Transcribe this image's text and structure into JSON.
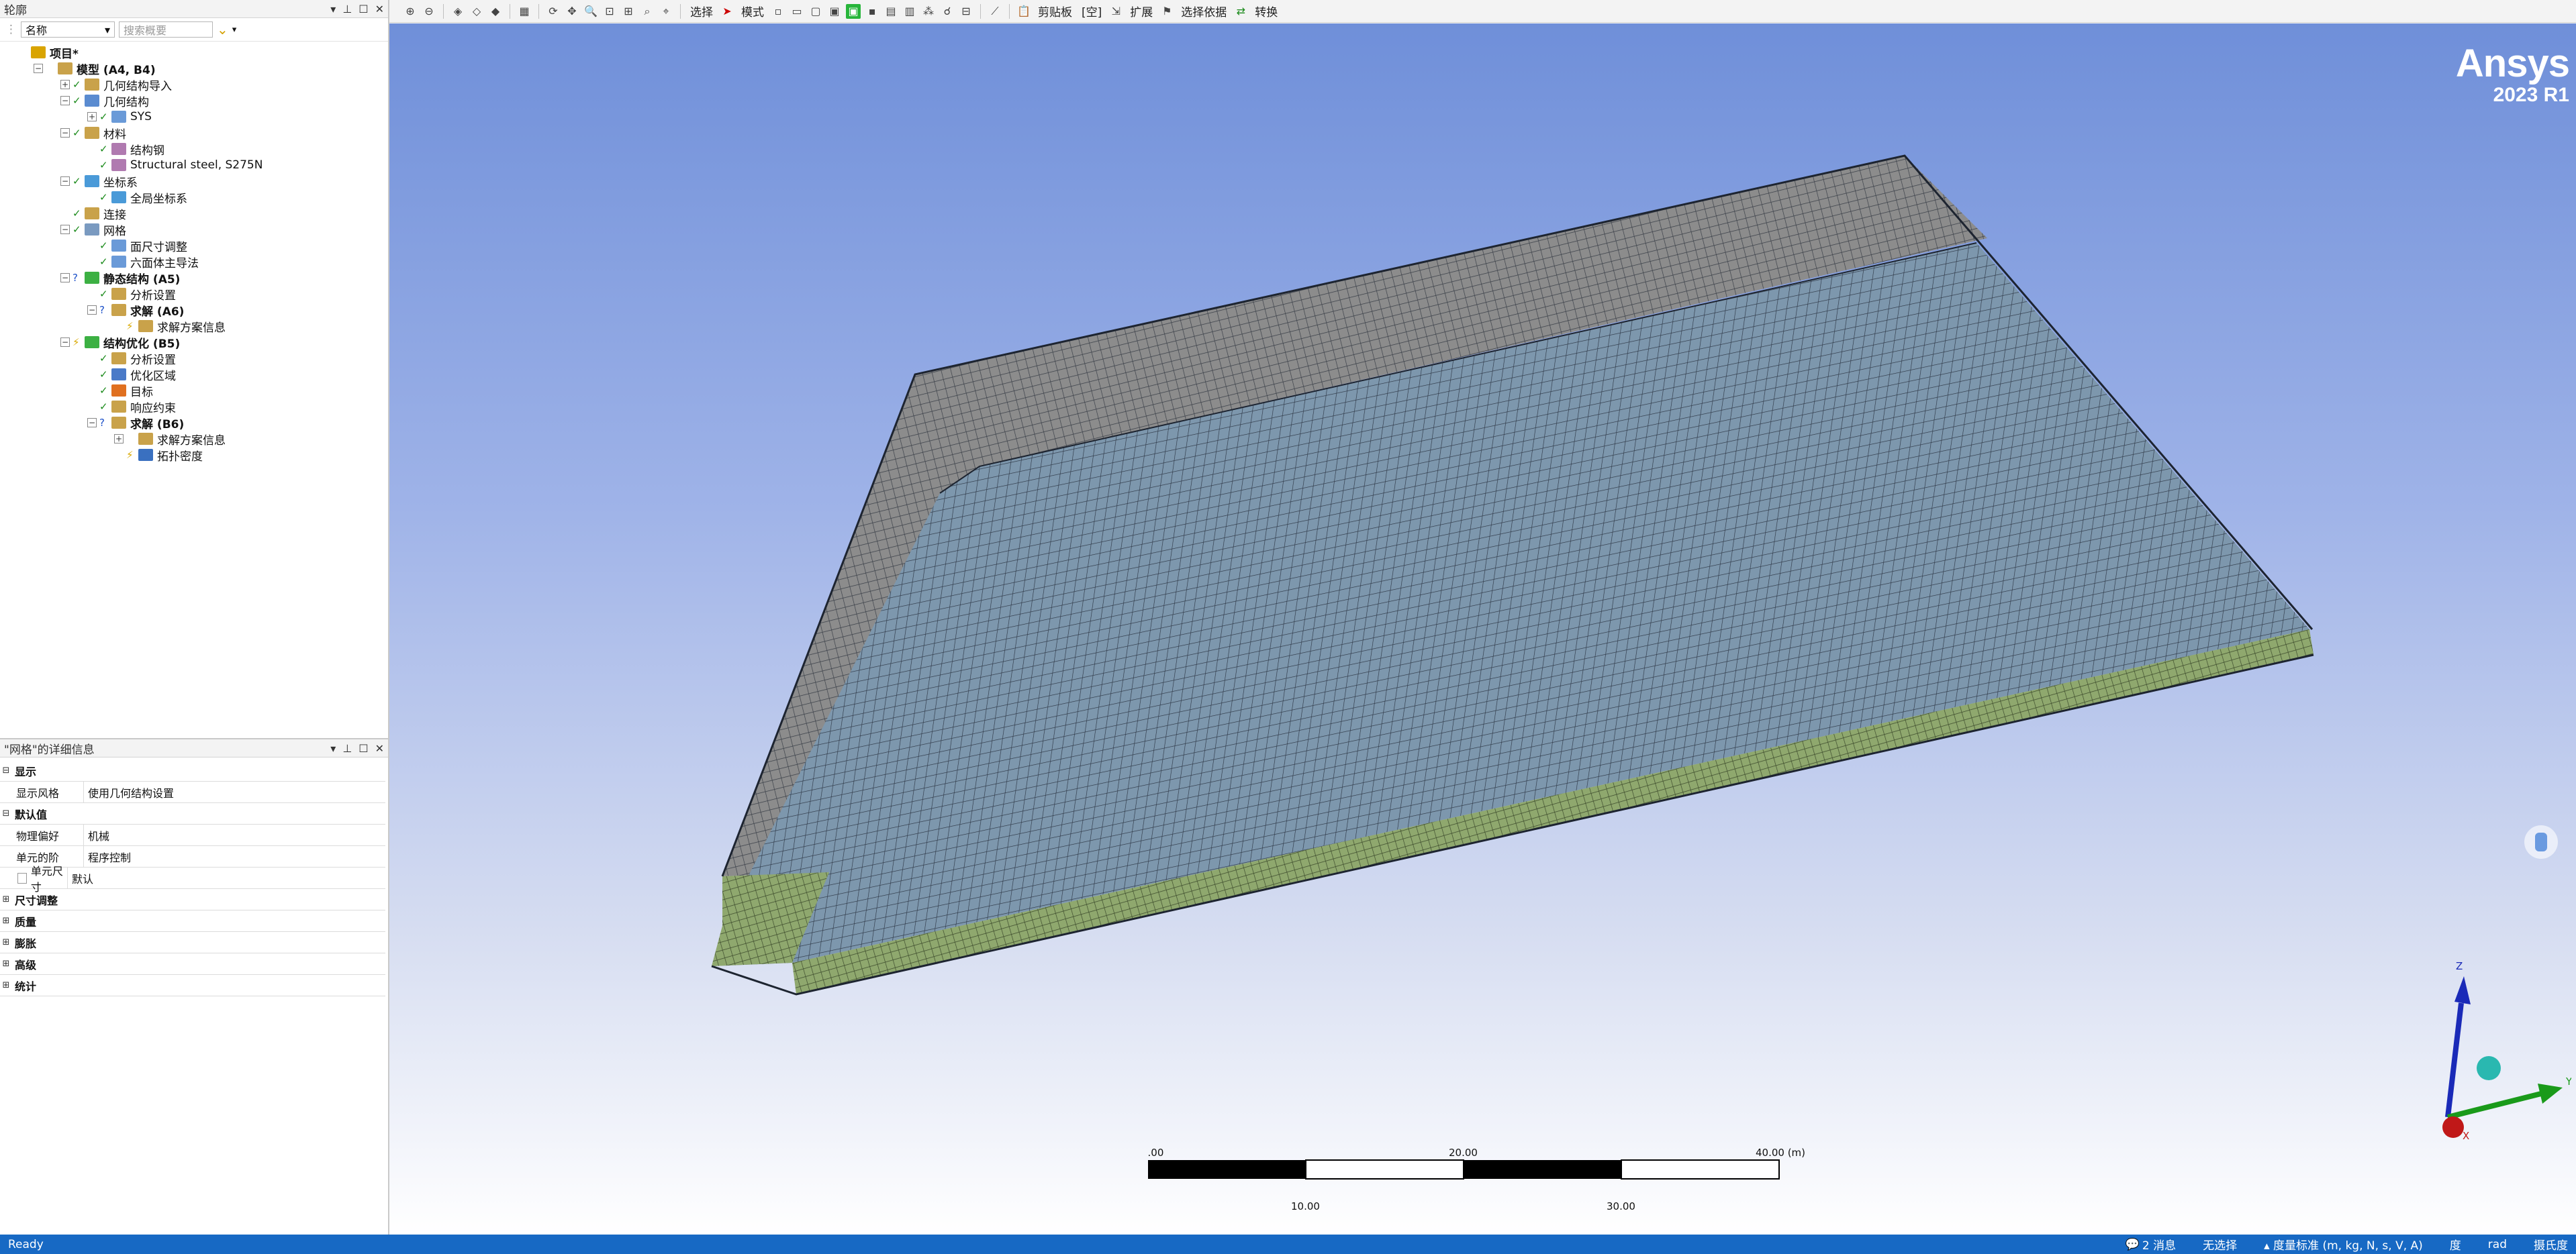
{
  "outline": {
    "title": "轮廓",
    "name_combo": "名称",
    "search_placeholder": "搜索概要",
    "tree": [
      {
        "label": "项目*",
        "level": 0,
        "exp": "",
        "status": "",
        "bold": true,
        "icon": "#d9a400"
      },
      {
        "label": "模型 (A4, B4)",
        "level": 1,
        "exp": "-",
        "status": "",
        "bold": true,
        "icon": "#c9a24a"
      },
      {
        "label": "几何结构导入",
        "level": 2,
        "exp": "+",
        "status": "✓",
        "bold": false,
        "icon": "#c9a24a"
      },
      {
        "label": "几何结构",
        "level": 2,
        "exp": "-",
        "status": "✓",
        "bold": false,
        "icon": "#5a8bd0"
      },
      {
        "label": "SYS",
        "level": 3,
        "exp": "+",
        "status": "✓",
        "bold": false,
        "icon": "#6a9ad8"
      },
      {
        "label": "材料",
        "level": 2,
        "exp": "-",
        "status": "✓",
        "bold": false,
        "icon": "#c9a24a"
      },
      {
        "label": "结构钢",
        "level": 3,
        "exp": "",
        "status": "✓",
        "bold": false,
        "icon": "#b07ab0"
      },
      {
        "label": "Structural steel, S275N",
        "level": 3,
        "exp": "",
        "status": "✓",
        "bold": false,
        "icon": "#b07ab0"
      },
      {
        "label": "坐标系",
        "level": 2,
        "exp": "-",
        "status": "✓",
        "bold": false,
        "icon": "#4a9ad8"
      },
      {
        "label": "全局坐标系",
        "level": 3,
        "exp": "",
        "status": "✓",
        "bold": false,
        "icon": "#4a9ad8"
      },
      {
        "label": "连接",
        "level": 2,
        "exp": "",
        "status": "✓",
        "bold": false,
        "icon": "#c9a24a"
      },
      {
        "label": "网格",
        "level": 2,
        "exp": "-",
        "status": "✓",
        "bold": false,
        "icon": "#7a9ac0"
      },
      {
        "label": "面尺寸调整",
        "level": 3,
        "exp": "",
        "status": "✓",
        "bold": false,
        "icon": "#6a9ad8"
      },
      {
        "label": "六面体主导法",
        "level": 3,
        "exp": "",
        "status": "✓",
        "bold": false,
        "icon": "#6a9ad8"
      },
      {
        "label": "静态结构 (A5)",
        "level": 2,
        "exp": "-",
        "status": "?",
        "bold": true,
        "icon": "#3cb043"
      },
      {
        "label": "分析设置",
        "level": 3,
        "exp": "",
        "status": "✓",
        "bold": false,
        "icon": "#c9a24a"
      },
      {
        "label": "求解 (A6)",
        "level": 3,
        "exp": "-",
        "status": "?",
        "bold": true,
        "icon": "#c9a24a"
      },
      {
        "label": "求解方案信息",
        "level": 4,
        "exp": "",
        "status": "⚡",
        "bold": false,
        "icon": "#c9a24a"
      },
      {
        "label": "结构优化 (B5)",
        "level": 2,
        "exp": "-",
        "status": "⚡",
        "bold": true,
        "icon": "#3cb043"
      },
      {
        "label": "分析设置",
        "level": 3,
        "exp": "",
        "status": "✓",
        "bold": false,
        "icon": "#c9a24a"
      },
      {
        "label": "优化区域",
        "level": 3,
        "exp": "",
        "status": "✓",
        "bold": false,
        "icon": "#4a7ac8"
      },
      {
        "label": "目标",
        "level": 3,
        "exp": "",
        "status": "✓",
        "bold": false,
        "icon": "#e07020"
      },
      {
        "label": "响应约束",
        "level": 3,
        "exp": "",
        "status": "✓",
        "bold": false,
        "icon": "#c9a24a"
      },
      {
        "label": "求解 (B6)",
        "level": 3,
        "exp": "-",
        "status": "?",
        "bold": true,
        "icon": "#c9a24a"
      },
      {
        "label": "求解方案信息",
        "level": 4,
        "exp": "+",
        "status": "",
        "bold": false,
        "icon": "#c9a24a"
      },
      {
        "label": "拓扑密度",
        "level": 4,
        "exp": "",
        "status": "⚡",
        "bold": false,
        "icon": "#3a70c0"
      }
    ]
  },
  "details": {
    "title": "\"网格\"的详细信息",
    "rows": [
      {
        "type": "group",
        "exp": "-",
        "key": "显示",
        "val": ""
      },
      {
        "type": "prop",
        "exp": "",
        "key": "显示风格",
        "val": "使用几何结构设置"
      },
      {
        "type": "group",
        "exp": "-",
        "key": "默认值",
        "val": ""
      },
      {
        "type": "prop",
        "exp": "",
        "key": "物理偏好",
        "val": "机械"
      },
      {
        "type": "prop",
        "exp": "",
        "key": "单元的阶",
        "val": "程序控制"
      },
      {
        "type": "check",
        "exp": "",
        "key": "单元尺寸",
        "val": "默认"
      },
      {
        "type": "group",
        "exp": "+",
        "key": "尺寸调整",
        "val": ""
      },
      {
        "type": "group",
        "exp": "+",
        "key": "质量",
        "val": ""
      },
      {
        "type": "group",
        "exp": "+",
        "key": "膨胀",
        "val": ""
      },
      {
        "type": "group",
        "exp": "+",
        "key": "高级",
        "val": ""
      },
      {
        "type": "group",
        "exp": "+",
        "key": "统计",
        "val": ""
      }
    ]
  },
  "toolbar": {
    "select": "选择",
    "mode": "模式",
    "clipboard": "剪贴板",
    "empty": "[空]",
    "extend": "扩展",
    "select_by": "选择依据",
    "convert": "转换"
  },
  "viewport": {
    "brand": "Ansys",
    "version": "2023 R1",
    "scale_labels_top": [
      "0.00",
      "20.00",
      "40.00 (m)"
    ],
    "scale_labels_bottom": [
      "10.00",
      "30.00"
    ],
    "axes": {
      "z": "Z",
      "y": "Y",
      "x": "X"
    }
  },
  "statusbar": {
    "ready": "Ready",
    "messages": "2 消息",
    "selection": "无选择",
    "units": "度量标准 (m, kg, N, s, V, A)",
    "deg": "度",
    "rad": "rad",
    "temp": "摄氏度"
  }
}
